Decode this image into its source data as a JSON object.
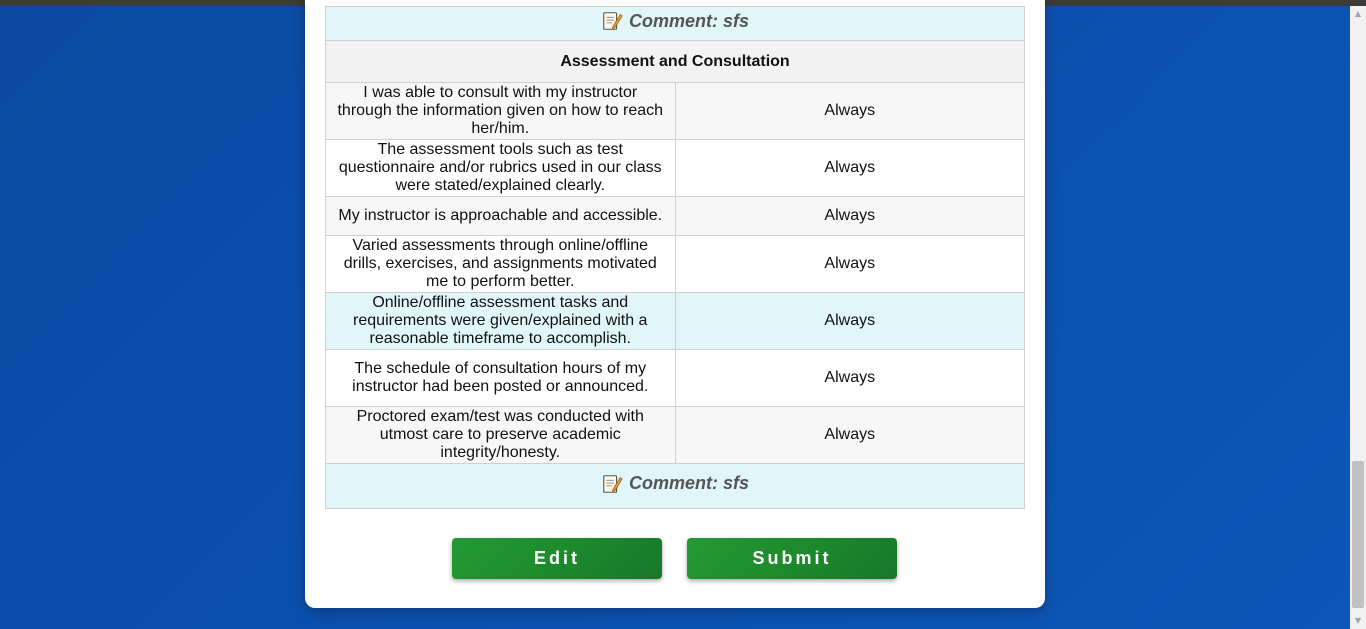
{
  "top_comment": {
    "text": "Comment: sfs"
  },
  "section": {
    "title": "Assessment and Consultation",
    "rows": [
      {
        "question": "I was able to consult with my instructor through the information given on how to reach her/him.",
        "answer": "Always"
      },
      {
        "question": "The assessment tools such as test questionnaire and/or rubrics used in our class were stated/explained clearly.",
        "answer": "Always"
      },
      {
        "question": "My instructor is approachable and accessible.",
        "answer": "Always"
      },
      {
        "question": "Varied assessments through online/offline drills, exercises, and assignments motivated me to perform better.",
        "answer": "Always"
      },
      {
        "question": "Online/offline assessment tasks and requirements were given/explained with a reasonable timeframe to accomplish.",
        "answer": "Always"
      },
      {
        "question": "The schedule of consultation hours of my instructor had been posted or announced.",
        "answer": "Always"
      },
      {
        "question": "Proctored exam/test was conducted with utmost care to preserve academic integrity/honesty.",
        "answer": "Always"
      }
    ],
    "comment": "Comment: sfs"
  },
  "buttons": {
    "edit": "Edit",
    "submit": "Submit"
  },
  "colors": {
    "background": "#0b4fac",
    "button": "#1d8a2c",
    "highlight_row": "#e0f6f8"
  },
  "icons": {
    "comment": "memo-icon",
    "scroll_up": "scroll-up-arrow-icon",
    "scroll_down": "scroll-down-arrow-icon"
  }
}
